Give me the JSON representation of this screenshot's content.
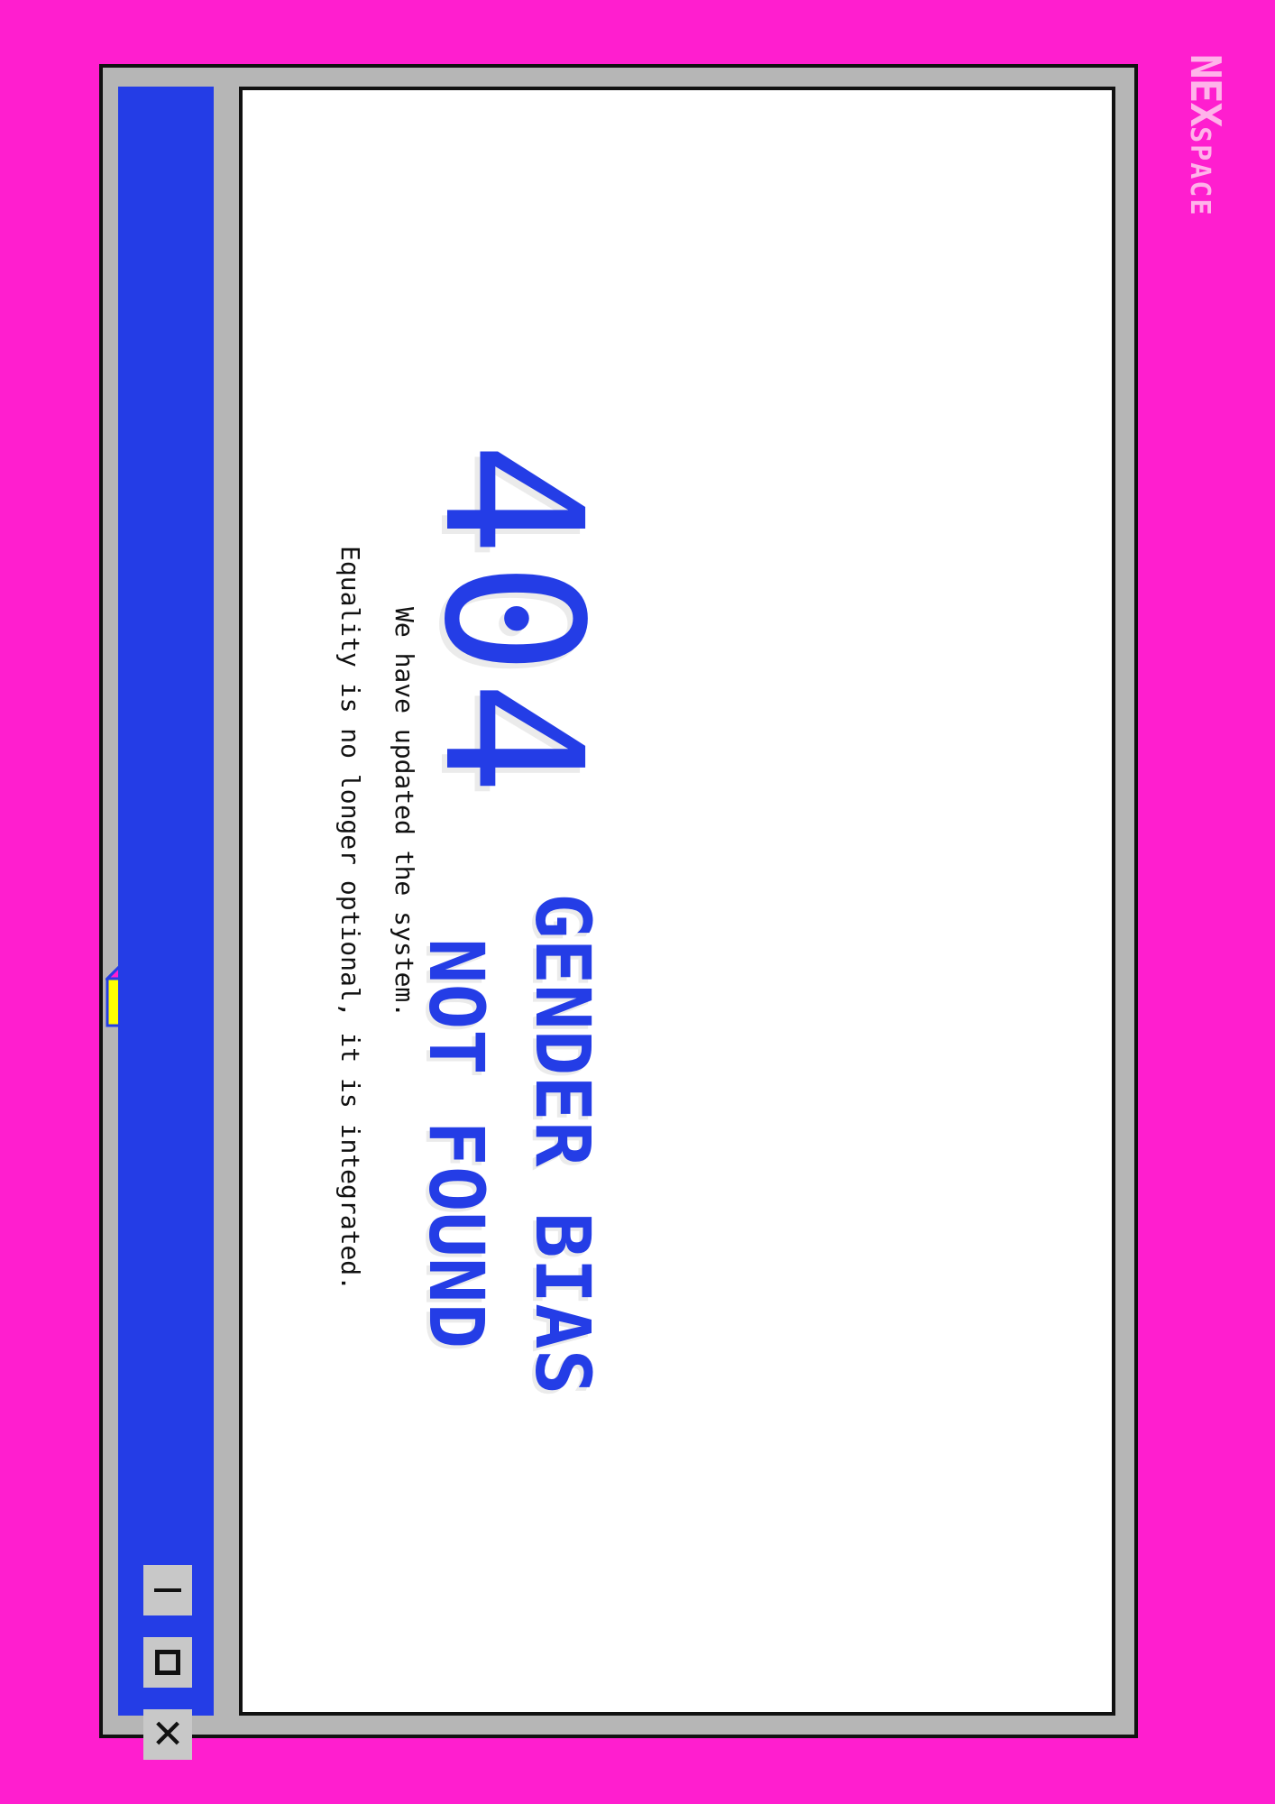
{
  "brand": {
    "part1": "NEX",
    "part2": "SPACE"
  },
  "window": {
    "title": "",
    "controls": {
      "minimize": "minimize",
      "maximize": "maximize",
      "close": "close"
    }
  },
  "main": {
    "code": "404",
    "headline_line1": "GENDER BIAS",
    "headline_line2": "NOT FOUND",
    "line1": "We have updated the system.",
    "line2": "Equality is no longer optional, it is integrated."
  },
  "icons": {
    "window_minimize": "minimize-icon",
    "window_maximize": "maximize-icon",
    "window_close": "close-icon",
    "error_document": "sad-document-icon"
  },
  "colors": {
    "background": "#ff1ecf",
    "accent": "#243de6",
    "window_frame": "#b6b6b6",
    "document_fill": "#ffff00",
    "brand": "#ffb3ea"
  }
}
